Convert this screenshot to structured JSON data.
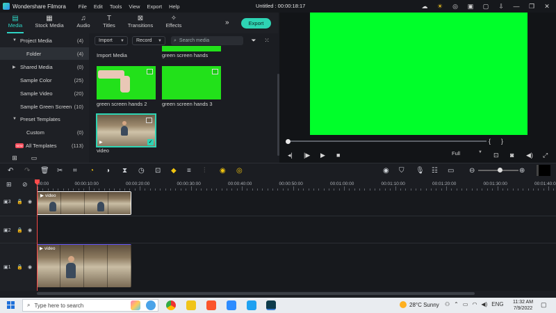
{
  "app": {
    "name": "Wondershare Filmora",
    "menu": [
      "File",
      "Edit",
      "Tools",
      "View",
      "Export",
      "Help"
    ],
    "doc_title": "Untitled : 00:00:18:17"
  },
  "media_tabs": [
    {
      "label": "Media",
      "icon": "folder-icon",
      "active": true
    },
    {
      "label": "Stock Media",
      "icon": "stock-icon",
      "active": false
    },
    {
      "label": "Audio",
      "icon": "music-icon",
      "active": false
    },
    {
      "label": "Titles",
      "icon": "text-icon",
      "active": false
    },
    {
      "label": "Transitions",
      "icon": "transition-icon",
      "active": false
    },
    {
      "label": "Effects",
      "icon": "sparkle-icon",
      "active": false
    }
  ],
  "export_label": "Export",
  "sidebar": {
    "items": [
      {
        "label": "Project Media",
        "count": "(4)",
        "expanded": true
      },
      {
        "label": "Folder",
        "count": "(4)",
        "selected": true
      },
      {
        "label": "Shared Media",
        "count": "(0)"
      },
      {
        "label": "Sample Color",
        "count": "(25)"
      },
      {
        "label": "Sample Video",
        "count": "(20)"
      },
      {
        "label": "Sample Green Screen",
        "count": "(10)"
      },
      {
        "label": "Preset Templates",
        "count": ""
      },
      {
        "label": "Custom",
        "count": "(0)"
      },
      {
        "label": "All Templates",
        "count": "(113)",
        "badge": "NEW"
      }
    ]
  },
  "media_toolbar": {
    "import_label": "Import",
    "record_label": "Record",
    "search_placeholder": "Search media"
  },
  "media_items": [
    {
      "caption": "Import Media"
    },
    {
      "caption": "green screen hands"
    },
    {
      "caption": "green screen hands 2"
    },
    {
      "caption": "green screen hands 3"
    },
    {
      "caption": "video"
    }
  ],
  "preview": {
    "zoom_label": "Full",
    "bracket_in": "{",
    "bracket_out": "}"
  },
  "ruler_labels": [
    "00:00",
    "00:00:10:00",
    "00:00:20:00",
    "00:00:30:00",
    "00:00:40:00",
    "00:00:50:00",
    "00:01:00:00",
    "00:01:10:00",
    "00:01:20:00",
    "00:01:30:00",
    "00:01:40:00"
  ],
  "tracks": [
    {
      "num": "3",
      "clip_label": "video"
    },
    {
      "num": "2",
      "clip_label": ""
    },
    {
      "num": "1",
      "clip_label": "video"
    }
  ],
  "taskbar": {
    "search_placeholder": "Type here to search",
    "weather": "28°C  Sunny",
    "lang": "ENG",
    "time": "11:32 AM",
    "date": "7/9/2022"
  }
}
